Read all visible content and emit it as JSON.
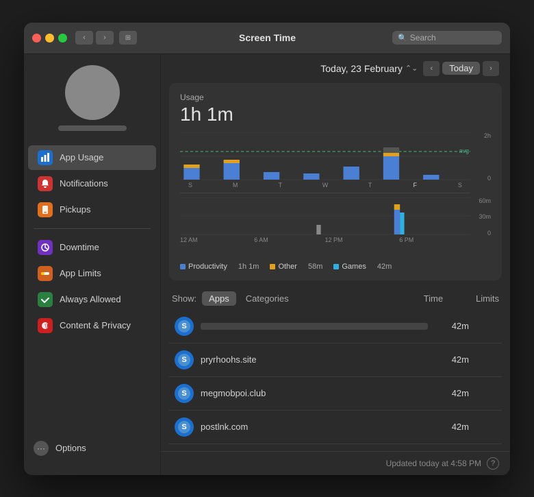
{
  "window": {
    "title": "Screen Time"
  },
  "titlebar": {
    "back_label": "‹",
    "forward_label": "›",
    "grid_label": "⊞",
    "search_placeholder": "Search",
    "search_icon": "🔍"
  },
  "date_header": {
    "date": "Today, 23 February",
    "today_label": "Today",
    "prev_label": "‹",
    "next_label": "›"
  },
  "usage": {
    "label": "Usage",
    "time": "1h 1m"
  },
  "chart": {
    "weekly_days": [
      "S",
      "M",
      "T",
      "W",
      "T",
      "F",
      "S"
    ],
    "weekly_y_top": "2h",
    "weekly_y_bottom": "0",
    "avg_label": "avg",
    "daily_times": [
      "12 AM",
      "6 AM",
      "12 PM",
      "6 PM",
      ""
    ],
    "daily_y_top": "60m",
    "daily_y_mid": "30m",
    "daily_y_bottom": "0"
  },
  "legend": [
    {
      "color": "#4a7fd4",
      "label": "Productivity",
      "time": "1h 1m"
    },
    {
      "color": "#e0a020",
      "label": "Other",
      "time": "58m"
    },
    {
      "color": "#30b0e0",
      "label": "Games",
      "time": "42m"
    }
  ],
  "show_bar": {
    "show_label": "Show:",
    "tab_apps": "Apps",
    "tab_categories": "Categories",
    "col_time": "Time",
    "col_limits": "Limits"
  },
  "apps": [
    {
      "icon": "safari",
      "name": "",
      "name_type": "bar",
      "time": "42m"
    },
    {
      "icon": "safari",
      "name": "pryrhoohs.site",
      "name_type": "text",
      "time": "42m"
    },
    {
      "icon": "safari",
      "name": "megmobpoi.club",
      "name_type": "text",
      "time": "42m"
    },
    {
      "icon": "safari",
      "name": "postlnk.com",
      "name_type": "text",
      "time": "42m"
    }
  ],
  "footer": {
    "updated_text": "Updated today at 4:58 PM"
  },
  "sidebar": {
    "items": [
      {
        "label": "App Usage",
        "icon": "📊",
        "icon_class": "icon-blue",
        "active": true
      },
      {
        "label": "Notifications",
        "icon": "🔔",
        "icon_class": "icon-red"
      },
      {
        "label": "Pickups",
        "icon": "📱",
        "icon_class": "icon-orange"
      },
      {
        "label": "Downtime",
        "icon": "🌙",
        "icon_class": "icon-purple"
      },
      {
        "label": "App Limits",
        "icon": "⏱",
        "icon_class": "icon-orange2"
      },
      {
        "label": "Always Allowed",
        "icon": "✓",
        "icon_class": "icon-green"
      },
      {
        "label": "Content & Privacy",
        "icon": "🛡",
        "icon_class": "icon-redcircle"
      }
    ],
    "options_label": "Options"
  }
}
